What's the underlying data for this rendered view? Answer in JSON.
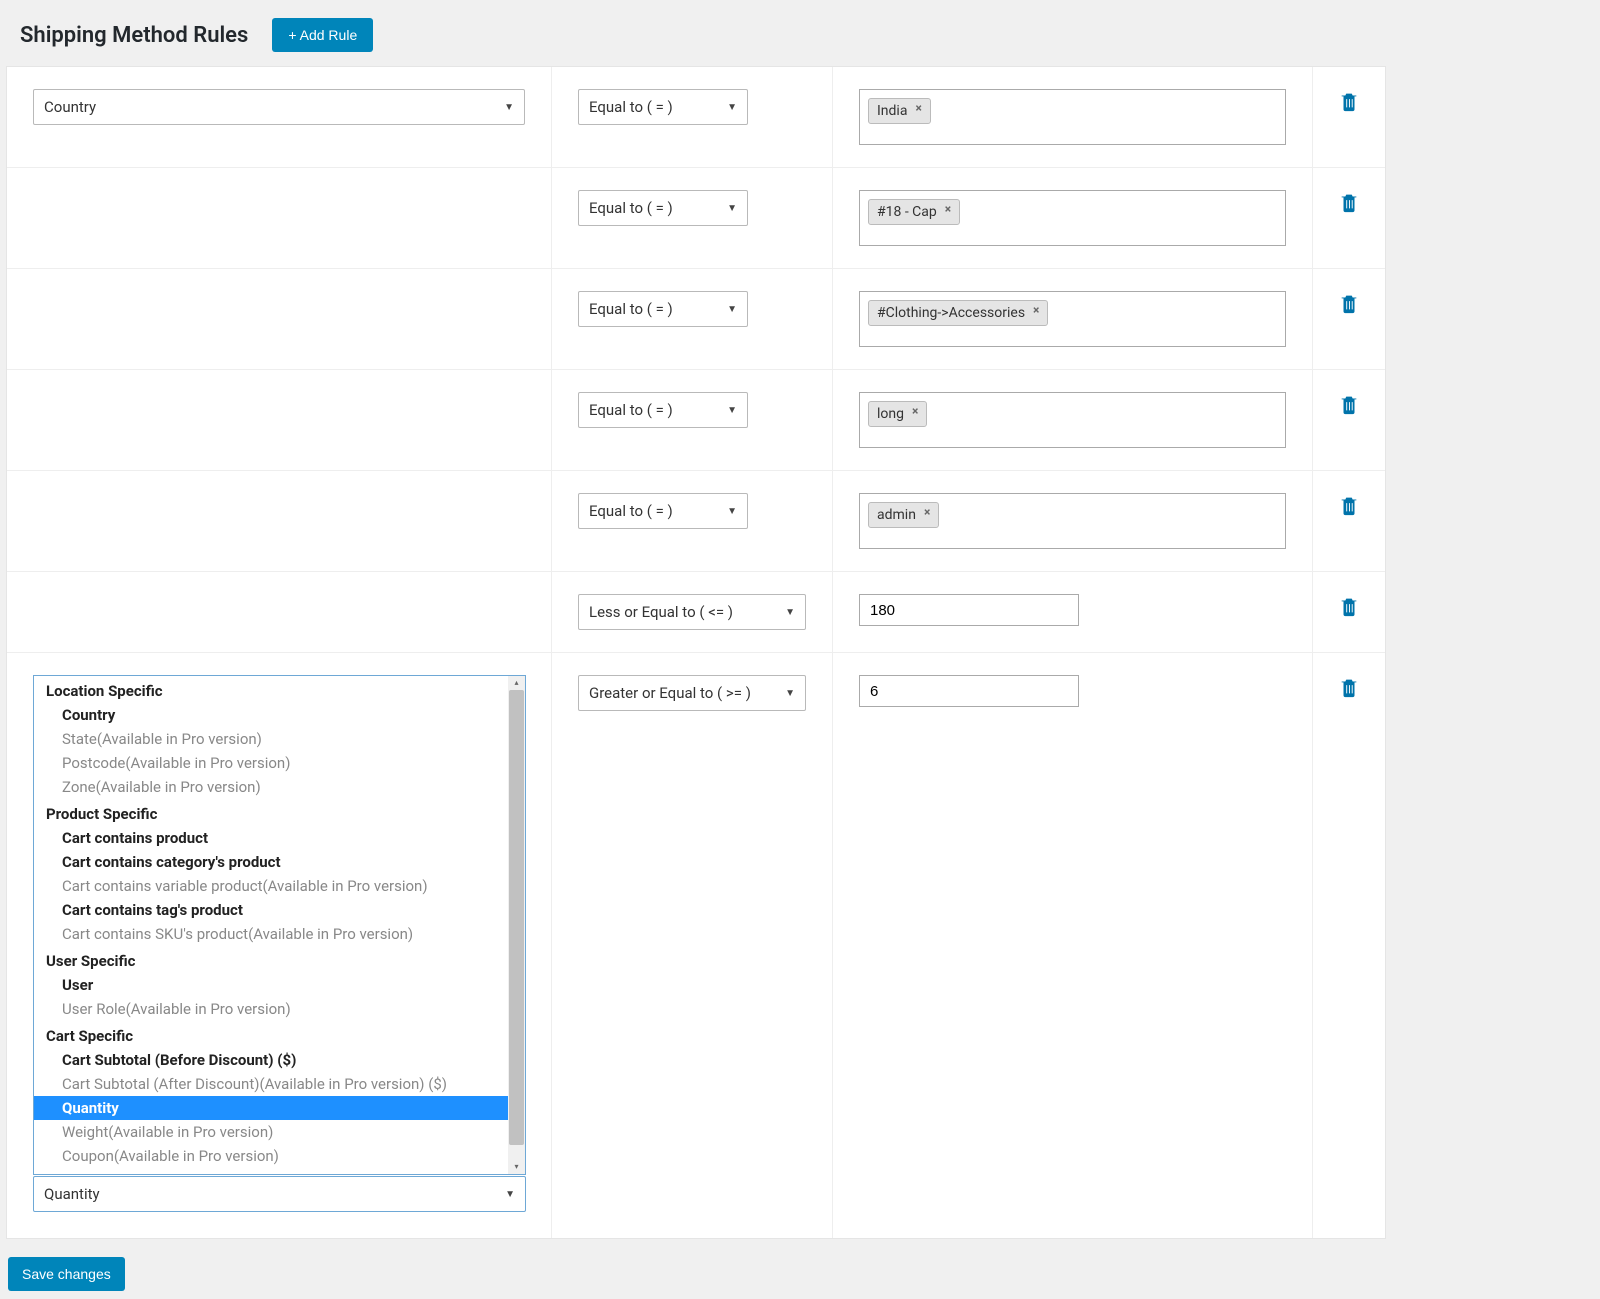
{
  "header": {
    "title": "Shipping Method Rules",
    "add_button": "+ Add Rule"
  },
  "operators": {
    "equal": "Equal to ( = )",
    "lte": "Less or Equal to ( <= )",
    "gte": "Greater or Equal to ( >= )"
  },
  "rows": [
    {
      "condition": "Country",
      "operator_key": "equal",
      "value_tags": [
        "India"
      ],
      "wide_op": false
    },
    {
      "condition": null,
      "operator_key": "equal",
      "value_tags": [
        "#18 - Cap"
      ],
      "wide_op": false
    },
    {
      "condition": null,
      "operator_key": "equal",
      "value_tags": [
        "#Clothing->Accessories"
      ],
      "wide_op": false
    },
    {
      "condition": null,
      "operator_key": "equal",
      "value_tags": [
        "long"
      ],
      "wide_op": false
    },
    {
      "condition": null,
      "operator_key": "equal",
      "value_tags": [
        "admin"
      ],
      "wide_op": false
    },
    {
      "condition": null,
      "operator_key": "lte",
      "value_text": "180",
      "wide_op": true
    },
    {
      "condition": "Quantity",
      "operator_key": "gte",
      "value_text": "6",
      "wide_op": true,
      "dropdown_open": true
    }
  ],
  "dropdown": {
    "groups": [
      {
        "label": "Location Specific",
        "items": [
          {
            "label": "Country",
            "enabled": true
          },
          {
            "label": "State(Available in Pro version)",
            "enabled": false
          },
          {
            "label": "Postcode(Available in Pro version)",
            "enabled": false
          },
          {
            "label": "Zone(Available in Pro version)",
            "enabled": false
          }
        ]
      },
      {
        "label": "Product Specific",
        "items": [
          {
            "label": "Cart contains product",
            "enabled": true
          },
          {
            "label": "Cart contains category's product",
            "enabled": true
          },
          {
            "label": "Cart contains variable product(Available in Pro version)",
            "enabled": false
          },
          {
            "label": "Cart contains tag's product",
            "enabled": true
          },
          {
            "label": "Cart contains SKU's product(Available in Pro version)",
            "enabled": false
          }
        ]
      },
      {
        "label": "User Specific",
        "items": [
          {
            "label": "User",
            "enabled": true
          },
          {
            "label": "User Role(Available in Pro version)",
            "enabled": false
          }
        ]
      },
      {
        "label": "Cart Specific",
        "items": [
          {
            "label": "Cart Subtotal (Before Discount) ($)",
            "enabled": true
          },
          {
            "label": "Cart Subtotal (After Discount)(Available in Pro version) ($)",
            "enabled": false
          },
          {
            "label": "Quantity",
            "enabled": true,
            "selected": true
          },
          {
            "label": "Weight(Available in Pro version)",
            "enabled": false
          },
          {
            "label": "Coupon(Available in Pro version)",
            "enabled": false
          }
        ]
      }
    ]
  },
  "footer": {
    "save": "Save changes"
  }
}
